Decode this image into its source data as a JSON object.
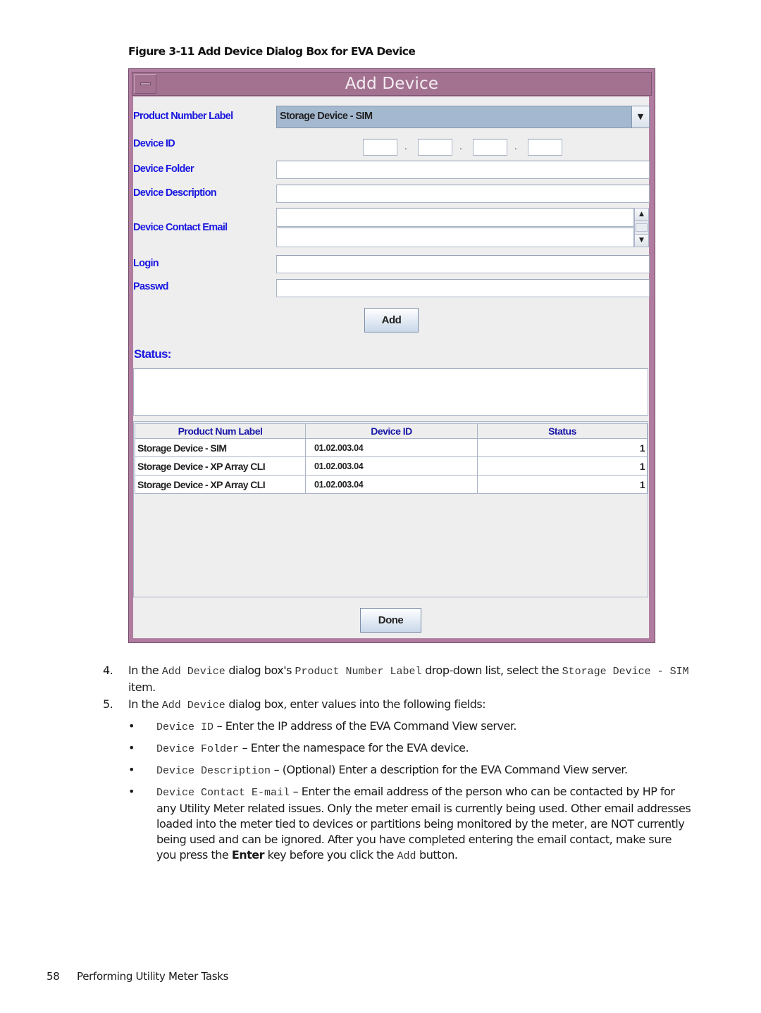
{
  "figure_caption": "Figure 3-11 Add Device Dialog Box for EVA Device",
  "dialog": {
    "title": "Add Device",
    "fields": {
      "product_number_label": {
        "label": "Product Number Label",
        "selected": "Storage Device - SIM"
      },
      "device_id": {
        "label": "Device ID",
        "octets": [
          "",
          "",
          "",
          ""
        ],
        "separator": "."
      },
      "device_folder": {
        "label": "Device Folder",
        "value": ""
      },
      "device_description": {
        "label": "Device Description",
        "value": ""
      },
      "device_contact_email": {
        "label": "Device Contact Email",
        "values": [
          "",
          ""
        ]
      },
      "login": {
        "label": "Login",
        "value": ""
      },
      "passwd": {
        "label": "Passwd",
        "value": ""
      }
    },
    "add_button": "Add",
    "status_label": "Status:",
    "status_text": "",
    "table": {
      "columns": [
        "Product Num Label",
        "Device ID",
        "Status"
      ],
      "rows": [
        [
          "Storage Device - SIM",
          "01.02.003.04",
          "1"
        ],
        [
          "Storage Device - XP Array CLI",
          "01.02.003.04",
          "1"
        ],
        [
          "Storage Device - XP Array CLI",
          "01.02.003.04",
          "1"
        ]
      ]
    },
    "done_button": "Done"
  },
  "steps": {
    "step4": {
      "number": "4.",
      "parts": [
        "In the ",
        "Add Device",
        " dialog box's ",
        "Product Number Label",
        " drop-down list, select the ",
        "Storage Device - SIM",
        " item."
      ]
    },
    "step5": {
      "number": "5.",
      "parts": [
        "In the ",
        "Add Device",
        " dialog box, enter values into the following fields:"
      ]
    },
    "bullets": [
      {
        "code": "Device ID",
        "text": " – Enter the IP address of the EVA Command View server."
      },
      {
        "code": "Device Folder",
        "text": " – Enter the namespace for the EVA device."
      },
      {
        "code": "Device Description",
        "text": " – (Optional) Enter a description for the EVA Command View server."
      },
      {
        "code": "Device Contact E-mail",
        "text": " – Enter the email address of the person who can be contacted by HP for any Utility Meter related issues. Only the meter email is currently being used. Other email addresses loaded into the meter tied to devices or partitions being monitored by the meter, are NOT currently being used and can be ignored. After you have completed entering the email contact, make sure you press the ",
        "bold": "Enter",
        "text2": " key before you click the ",
        "code2": "Add",
        "text3": " button."
      }
    ],
    "bullet_glyph": "•"
  },
  "footer": {
    "page_number": "58",
    "section": "Performing Utility Meter Tasks"
  }
}
